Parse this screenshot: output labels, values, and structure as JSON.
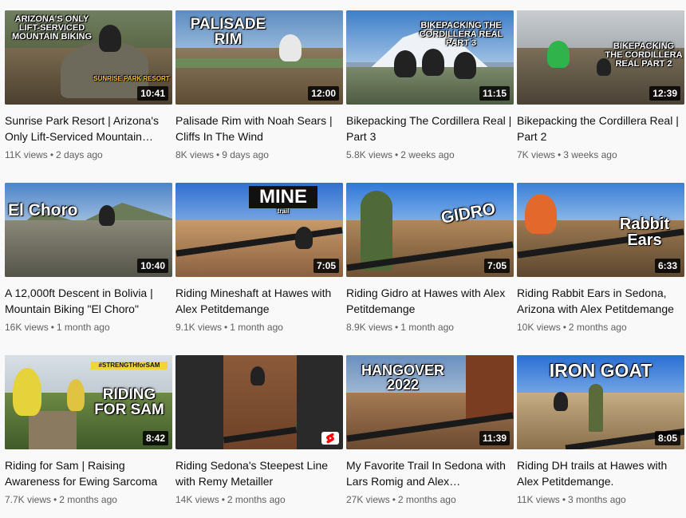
{
  "videos": [
    {
      "title": "Sunrise Park Resort | Arizona's Only Lift-Serviced Mountain Biking",
      "duration": "10:41",
      "views": "11K views",
      "age": "2 days ago",
      "overlay": "ARIZONA'S ONLY LIFT-SERVICED MOUNTAIN BIKING",
      "overlay2": "SUNRISE PARK RESORT"
    },
    {
      "title": "Palisade Rim with Noah Sears | Cliffs In The Wind",
      "duration": "12:00",
      "views": "8K views",
      "age": "9 days ago",
      "overlay": "PALISADE RIM"
    },
    {
      "title": "Bikepacking The Cordillera Real | Part 3",
      "duration": "11:15",
      "views": "5.8K views",
      "age": "2 weeks ago",
      "overlay": "BIKEPACKING THE CORDILLERA REAL PART 3"
    },
    {
      "title": "Bikepacking the Cordillera Real | Part 2",
      "duration": "12:39",
      "views": "7K views",
      "age": "3 weeks ago",
      "overlay": "BIKEPACKING THE CORDILLERA REAL PART 2"
    },
    {
      "title": "A 12,000ft Descent in Bolivia | Mountain Biking \"El Choro\"",
      "duration": "10:40",
      "views": "16K views",
      "age": "1 month ago",
      "overlay": "El Choro"
    },
    {
      "title": "Riding Mineshaft at Hawes with Alex Petitdemange",
      "duration": "7:05",
      "views": "9.1K views",
      "age": "1 month ago",
      "overlay": "MINE",
      "overlay2": "trail"
    },
    {
      "title": "Riding Gidro at Hawes with Alex Petitdemange",
      "duration": "7:05",
      "views": "8.9K views",
      "age": "1 month ago",
      "overlay": "GIDRO"
    },
    {
      "title": "Riding Rabbit Ears in Sedona, Arizona with Alex Petitdemange",
      "duration": "6:33",
      "views": "10K views",
      "age": "2 months ago",
      "overlay": "Rabbit Ears"
    },
    {
      "title": "Riding for Sam | Raising Awareness for Ewing Sarcoma",
      "duration": "8:42",
      "views": "7.7K views",
      "age": "2 months ago",
      "overlay": "RIDING FOR SAM",
      "overlay2": "#STRENGTHforSAM"
    },
    {
      "title": "Riding Sedona's Steepest Line with Remy Metailler",
      "duration": "",
      "views": "14K views",
      "age": "2 months ago",
      "overlay": ""
    },
    {
      "title": "My Favorite Trail In Sedona with Lars Romig and Alex Petitdemange",
      "duration": "11:39",
      "views": "27K views",
      "age": "2 months ago",
      "overlay": "HANGOVER 2022"
    },
    {
      "title": "Riding DH trails at Hawes with Alex Petitdemange.",
      "duration": "8:05",
      "views": "11K views",
      "age": "3 months ago",
      "overlay": "IRON GOAT"
    }
  ],
  "separator": "•",
  "colors": {
    "title": "#0f0f0f",
    "meta": "#606060",
    "background": "#f9f9f9",
    "shorts_red": "#ff0000"
  }
}
